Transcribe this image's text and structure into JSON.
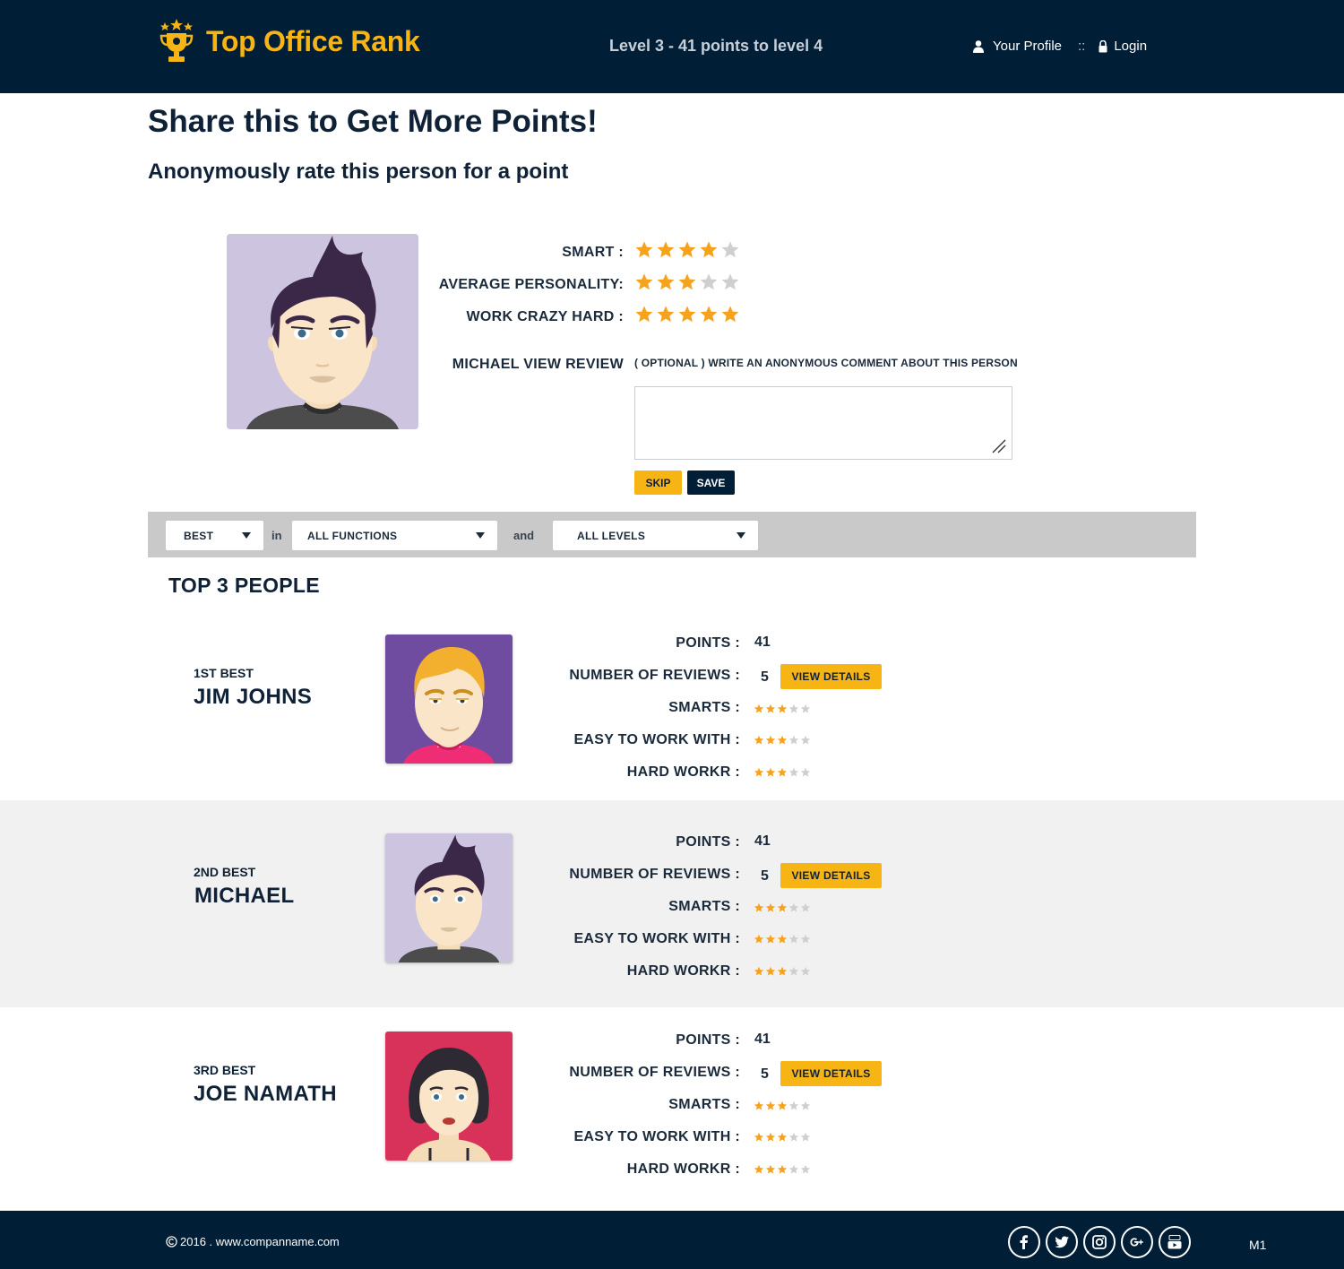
{
  "header": {
    "brand": "Top Office Rank",
    "level_status": "Level 3 - 41 points to level 4",
    "nav": {
      "profile_label": "Your Profile",
      "separator": "::",
      "login_label": "Login"
    }
  },
  "page": {
    "title": "Share this to Get More Points!",
    "subtitle": "Anonymously rate this person for a point"
  },
  "rating_form": {
    "criteria": [
      {
        "label": "SMART :",
        "stars": 4,
        "max": 5
      },
      {
        "label": "AVERAGE PERSONALITY:",
        "stars": 3,
        "max": 5
      },
      {
        "label": "WORK CRAZY HARD :",
        "stars": 5,
        "max": 5
      }
    ],
    "review_label": "MICHAEL VIEW REVIEW",
    "comment_hint": "( OPTIONAL ) WRITE AN ANONYMOUS COMMENT ABOUT THIS PERSON",
    "comment_value": "",
    "skip_label": "SKIP",
    "save_label": "SAVE"
  },
  "filters": {
    "rank_select": "BEST",
    "word_in": "in",
    "function_select": "ALL FUNCTIONS",
    "word_and": "and",
    "level_select": "ALL LEVELS"
  },
  "top3": {
    "title": "TOP 3 PEOPLE",
    "labels": {
      "points": "POINTS :",
      "reviews": "NUMBER OF REVIEWS :",
      "smarts": "SMARTS :",
      "easy": "EASY TO WORK WITH :",
      "hard": "HARD WORKR :",
      "details_button": "VIEW DETAILS"
    },
    "people": [
      {
        "rank": "1ST BEST",
        "name": "JIM JOHNS",
        "points": "41",
        "reviews": "5",
        "smarts": 3,
        "easy": 3,
        "hard": 3
      },
      {
        "rank": "2ND BEST",
        "name": "MICHAEL",
        "points": "41",
        "reviews": "5",
        "smarts": 3,
        "easy": 3,
        "hard": 3
      },
      {
        "rank": "3RD BEST",
        "name": "JOE NAMATH",
        "points": "41",
        "reviews": "5",
        "smarts": 3,
        "easy": 3,
        "hard": 3
      }
    ]
  },
  "footer": {
    "copyright": "2016 . www.companname.com",
    "socials": [
      "facebook-icon",
      "twitter-icon",
      "instagram-icon",
      "google-plus-icon",
      "youtube-icon"
    ],
    "page_code": "M1"
  },
  "colors": {
    "navy": "#001e35",
    "accent": "#f7b515",
    "star_on": "#f7a21b",
    "star_off": "#cfcfcf"
  }
}
